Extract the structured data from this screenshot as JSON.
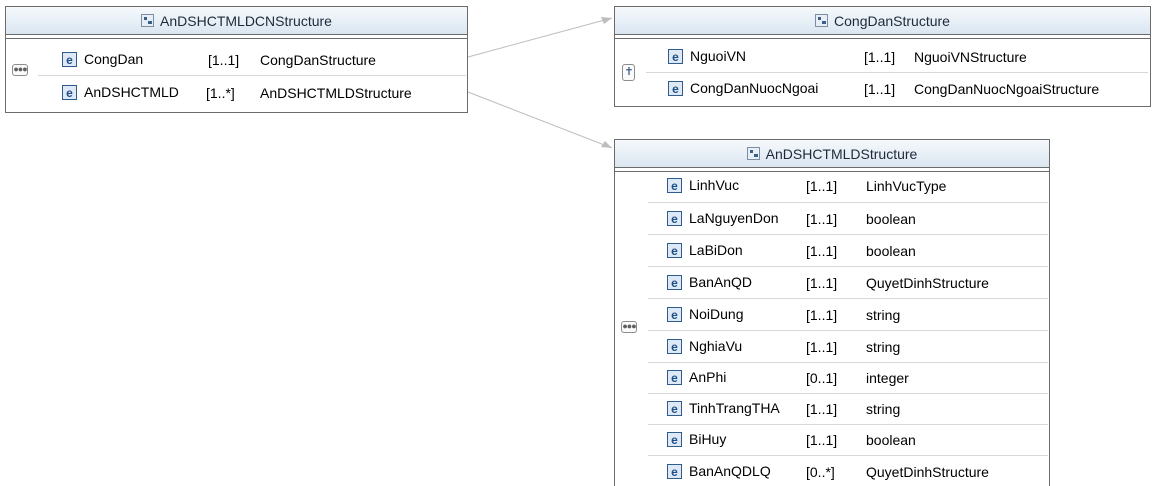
{
  "diagram": {
    "root": {
      "title": "AnDSHCTMLDCNStructure",
      "compositor_icon": "sequence-icon",
      "elements": [
        {
          "name": "CongDan",
          "card": "[1..1]",
          "type": "CongDanStructure"
        },
        {
          "name": "AnDSHCTMLD",
          "card": "[1..*]",
          "type": "AnDSHCTMLDStructure"
        }
      ]
    },
    "congdan": {
      "title": "CongDanStructure",
      "compositor_icon": "choice-icon",
      "elements": [
        {
          "name": "NguoiVN",
          "card": "[1..1]",
          "type": "NguoiVNStructure"
        },
        {
          "name": "CongDanNuocNgoai",
          "card": "[1..1]",
          "type": "CongDanNuocNgoaiStructure"
        }
      ]
    },
    "andshctmld": {
      "title": "AnDSHCTMLDStructure",
      "compositor_icon": "sequence-icon",
      "elements": [
        {
          "name": "LinhVuc",
          "card": "[1..1]",
          "type": "LinhVucType"
        },
        {
          "name": "LaNguyenDon",
          "card": "[1..1]",
          "type": "boolean"
        },
        {
          "name": "LaBiDon",
          "card": "[1..1]",
          "type": "boolean"
        },
        {
          "name": "BanAnQD",
          "card": "[1..1]",
          "type": "QuyetDinhStructure"
        },
        {
          "name": "NoiDung",
          "card": "[1..1]",
          "type": "string"
        },
        {
          "name": "NghiaVu",
          "card": "[1..1]",
          "type": "string"
        },
        {
          "name": "AnPhi",
          "card": "[0..1]",
          "type": "integer"
        },
        {
          "name": "TinhTrangTHA",
          "card": "[1..1]",
          "type": "string"
        },
        {
          "name": "BiHuy",
          "card": "[1..1]",
          "type": "boolean"
        },
        {
          "name": "BanAnQDLQ",
          "card": "[0..*]",
          "type": "QuyetDinhStructure"
        }
      ]
    },
    "element_icon_letter": "e",
    "colors": {
      "header_top": "#f6f9fc",
      "header_bottom": "#dbe6f1",
      "connector": "#b5b5b5",
      "element_icon": "#1f4f86"
    }
  }
}
